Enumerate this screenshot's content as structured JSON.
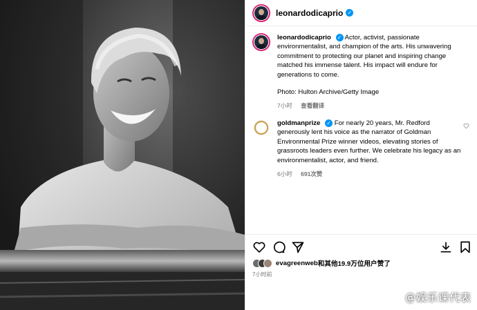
{
  "photo": {
    "alt": ""
  },
  "header": {
    "username": "leonardodicaprio",
    "verified_mark": "✓"
  },
  "caption": {
    "username": "leonardodicaprio",
    "text": "Actor, activist, passionate environmentalist, and champion of the arts. His unwavering commitment to protecting our planet and inspiring change matched his immense talent. His impact will endure for generations to come.",
    "photo_credit": "Photo: Hulton Archive/Getty Image",
    "time": "7小时",
    "translate": "查看翻译"
  },
  "comments": [
    {
      "username": "goldmanprize",
      "text": "For nearly 20 years, Mr. Redford generously lent his voice as the narrator of Goldman Environmental Prize winner videos, elevating stories of grassroots leaders even further. We celebrate his legacy as an environmentalist, actor, and friend.",
      "time": "6小时",
      "likes": "691次赞"
    }
  ],
  "actions": {
    "like_icon": "heart-icon",
    "comment_icon": "comment-icon",
    "share_icon": "send-icon",
    "save_icon": "bookmark-icon",
    "download_icon": "download-icon"
  },
  "likes": {
    "who": "evagreenweb",
    "rest": "和其他19.9万位用户赞了"
  },
  "post_time": "7小时前",
  "watermark": {
    "dots": "",
    "text": "@娱乐课代表"
  },
  "colors": {
    "verified": "#0095f6",
    "secondary_text": "#737373",
    "divider": "#efefef",
    "avatar_ring": "#d62976"
  }
}
